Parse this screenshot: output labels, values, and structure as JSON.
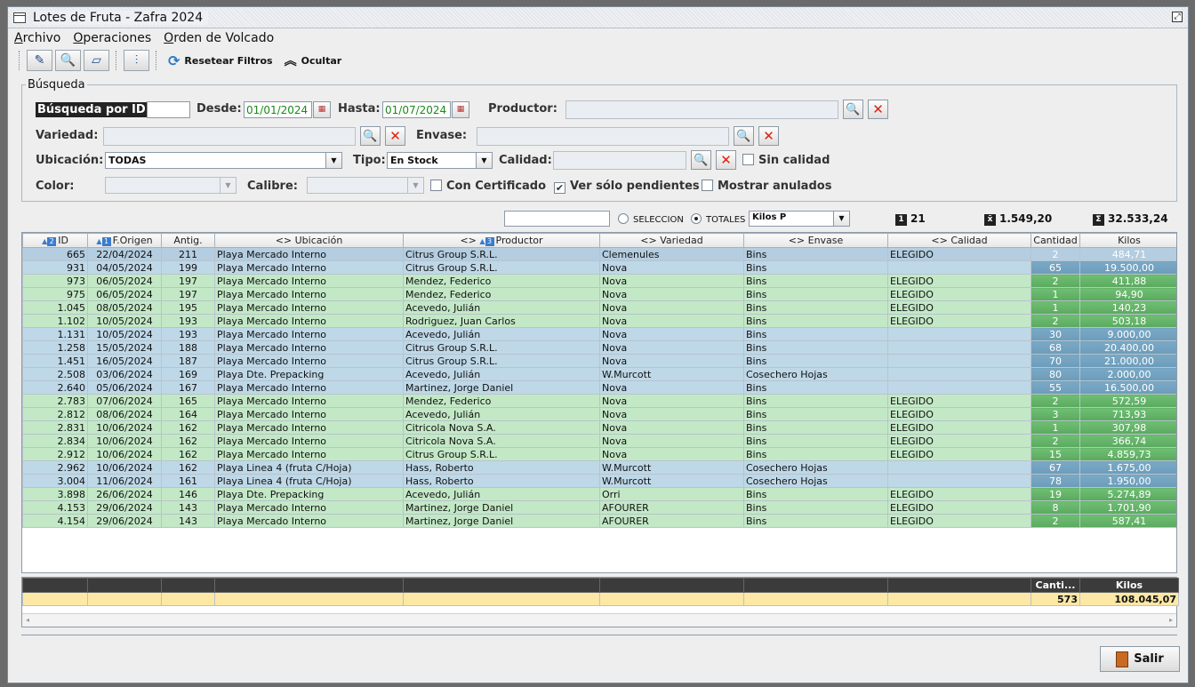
{
  "window": {
    "title": "Lotes de Fruta - Zafra 2024"
  },
  "menu": [
    "Archivo",
    "Operaciones",
    "Orden de Volcado"
  ],
  "toolbar": {
    "reset_label": "Resetear Filtros",
    "hide_label": "Ocultar"
  },
  "search": {
    "legend": "Búsqueda",
    "id_label": "Búsqueda por ID:",
    "desde_label": "Desde:",
    "desde_value": "01/01/2024",
    "hasta_label": "Hasta:",
    "hasta_value": "01/07/2024",
    "productor_label": "Productor:",
    "variedad_label": "Variedad:",
    "envase_label": "Envase:",
    "ubicacion_label": "Ubicación:",
    "ubicacion_value": "TODAS",
    "tipo_label": "Tipo:",
    "tipo_value": "En Stock",
    "calidad_label": "Calidad:",
    "sin_calidad_label": "Sin calidad",
    "color_label": "Color:",
    "calibre_label": "Calibre:",
    "con_certificado_label": "Con Certificado",
    "ver_pendientes_label": "Ver sólo pendientes",
    "mostrar_anulados_label": "Mostrar anulados"
  },
  "summary": {
    "seleccion_label": "SELECCION",
    "totales_label": "TOTALES",
    "combo_value": "Kilos P",
    "count_badge": "1",
    "count": "21",
    "avg_symbol": "x̄",
    "avg": "1.549,20",
    "sum_symbol": "Σ",
    "sum": "32.533,24"
  },
  "table": {
    "headers": [
      "ID",
      "F.Origen",
      "Antig.",
      "Ubicación",
      "Productor",
      "Variedad",
      "Envase",
      "Calidad",
      "Cantidad",
      "Kilos"
    ],
    "rows": [
      [
        "665",
        "22/04/2024",
        "211",
        "Playa Mercado Interno",
        "Citrus Group S.R.L.",
        "Clemenules",
        "Bins",
        "ELEGIDO",
        "2",
        "484,71"
      ],
      [
        "931",
        "04/05/2024",
        "199",
        "Playa Mercado Interno",
        "Citrus Group S.R.L.",
        "Nova",
        "Bins",
        "",
        "65",
        "19.500,00"
      ],
      [
        "973",
        "06/05/2024",
        "197",
        "Playa Mercado Interno",
        "Mendez, Federico",
        "Nova",
        "Bins",
        "ELEGIDO",
        "2",
        "411,88"
      ],
      [
        "975",
        "06/05/2024",
        "197",
        "Playa Mercado Interno",
        "Mendez, Federico",
        "Nova",
        "Bins",
        "ELEGIDO",
        "1",
        "94,90"
      ],
      [
        "1.045",
        "08/05/2024",
        "195",
        "Playa Mercado Interno",
        "Acevedo, Julián",
        "Nova",
        "Bins",
        "ELEGIDO",
        "1",
        "140,23"
      ],
      [
        "1.102",
        "10/05/2024",
        "193",
        "Playa Mercado Interno",
        "Rodriguez, Juan Carlos",
        "Nova",
        "Bins",
        "ELEGIDO",
        "2",
        "503,18"
      ],
      [
        "1.131",
        "10/05/2024",
        "193",
        "Playa Mercado Interno",
        "Acevedo, Julián",
        "Nova",
        "Bins",
        "",
        "30",
        "9.000,00"
      ],
      [
        "1.258",
        "15/05/2024",
        "188",
        "Playa Mercado Interno",
        "Citrus Group S.R.L.",
        "Nova",
        "Bins",
        "",
        "68",
        "20.400,00"
      ],
      [
        "1.451",
        "16/05/2024",
        "187",
        "Playa Mercado Interno",
        "Citrus Group S.R.L.",
        "Nova",
        "Bins",
        "",
        "70",
        "21.000,00"
      ],
      [
        "2.508",
        "03/06/2024",
        "169",
        "Playa Dte. Prepacking",
        "Acevedo, Julián",
        "W.Murcott",
        "Cosechero Hojas",
        "",
        "80",
        "2.000,00"
      ],
      [
        "2.640",
        "05/06/2024",
        "167",
        "Playa Mercado Interno",
        "Martinez, Jorge Daniel",
        "Nova",
        "Bins",
        "",
        "55",
        "16.500,00"
      ],
      [
        "2.783",
        "07/06/2024",
        "165",
        "Playa Mercado Interno",
        "Mendez, Federico",
        "Nova",
        "Bins",
        "ELEGIDO",
        "2",
        "572,59"
      ],
      [
        "2.812",
        "08/06/2024",
        "164",
        "Playa Mercado Interno",
        "Acevedo, Julián",
        "Nova",
        "Bins",
        "ELEGIDO",
        "3",
        "713,93"
      ],
      [
        "2.831",
        "10/06/2024",
        "162",
        "Playa Mercado Interno",
        "Citricola Nova S.A.",
        "Nova",
        "Bins",
        "ELEGIDO",
        "1",
        "307,98"
      ],
      [
        "2.834",
        "10/06/2024",
        "162",
        "Playa Mercado Interno",
        "Citricola Nova S.A.",
        "Nova",
        "Bins",
        "ELEGIDO",
        "2",
        "366,74"
      ],
      [
        "2.912",
        "10/06/2024",
        "162",
        "Playa Mercado Interno",
        "Citrus Group S.R.L.",
        "Nova",
        "Bins",
        "ELEGIDO",
        "15",
        "4.859,73"
      ],
      [
        "2.962",
        "10/06/2024",
        "162",
        "Playa Linea 4 (fruta C/Hoja)",
        "Hass, Roberto",
        "W.Murcott",
        "Cosechero Hojas",
        "",
        "67",
        "1.675,00"
      ],
      [
        "3.004",
        "11/06/2024",
        "161",
        "Playa Linea 4 (fruta C/Hoja)",
        "Hass, Roberto",
        "W.Murcott",
        "Cosechero Hojas",
        "",
        "78",
        "1.950,00"
      ],
      [
        "3.898",
        "26/06/2024",
        "146",
        "Playa Dte. Prepacking",
        "Acevedo, Julián",
        "Orri",
        "Bins",
        "ELEGIDO",
        "19",
        "5.274,89"
      ],
      [
        "4.153",
        "29/06/2024",
        "143",
        "Playa Mercado Interno",
        "Martinez, Jorge Daniel",
        "AFOURER",
        "Bins",
        "ELEGIDO",
        "8",
        "1.701,90"
      ],
      [
        "4.154",
        "29/06/2024",
        "143",
        "Playa Mercado Interno",
        "Martinez, Jorge Daniel",
        "AFOURER",
        "Bins",
        "ELEGIDO",
        "2",
        "587,41"
      ]
    ]
  },
  "totals": {
    "cantidad_header": "Canti...",
    "kilos_header": "Kilos",
    "cantidad": "573",
    "kilos": "108.045,07"
  },
  "footer": {
    "salir_label": "Salir"
  }
}
